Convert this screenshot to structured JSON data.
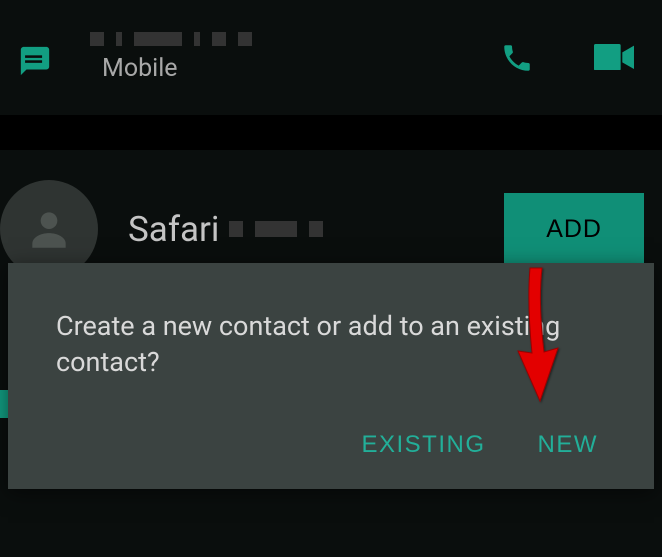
{
  "header": {
    "mobile_label": "Mobile"
  },
  "contact": {
    "name": "Safari",
    "add_button_label": "ADD"
  },
  "dialog": {
    "message": "Create a new contact or add to an existing contact?",
    "existing_label": "EXISTING",
    "new_label": "NEW"
  },
  "colors": {
    "accent": "#129e82",
    "dialog_bg": "#3b4341",
    "background": "#0a0e0d"
  }
}
